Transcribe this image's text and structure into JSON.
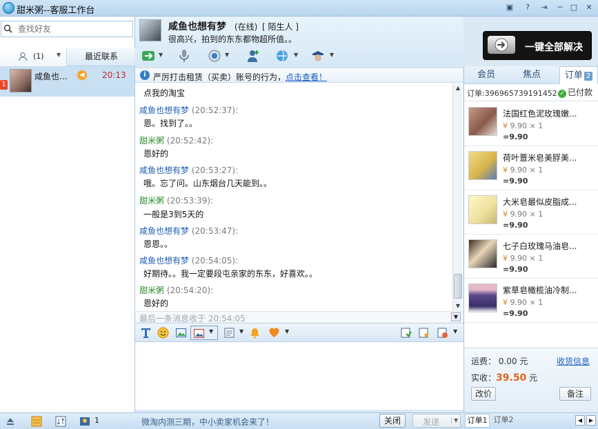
{
  "window": {
    "title": "甜米粥--客服工作台",
    "buttons": [
      "▣",
      "?",
      "⇥",
      "─",
      "□",
      "✕"
    ]
  },
  "sidebar": {
    "search_placeholder": "查找好友",
    "tab_contacts_count": "(1)",
    "tab_recent": "最近联系",
    "contact": {
      "name": "咸鱼也...",
      "time": "20:13",
      "unread": "1"
    }
  },
  "header": {
    "name": "咸鱼也想有梦",
    "status": "(在线)",
    "tag": "[ 陌生人 ]",
    "signature": "很高兴，拍到的东东都物超所值。。",
    "banner_text": "一键全部解决"
  },
  "notice": {
    "text": "严厉打击租赁（买卖）账号的行为，",
    "link": "点击查看！"
  },
  "chat": {
    "first_line": "点我的淘宝",
    "messages": [
      {
        "sender": "咸鱼也想有梦",
        "time": "(20:52:37):",
        "text": "恩。找到了。。",
        "self": false
      },
      {
        "sender": "甜米粥",
        "time": "(20:52:42):",
        "text": "恩好的",
        "self": true
      },
      {
        "sender": "咸鱼也想有梦",
        "time": "(20:53:27):",
        "text": "哦。忘了问。山东烟台几天能到。。",
        "self": false
      },
      {
        "sender": "甜米粥",
        "time": "(20:53:39):",
        "text": "一般是3到5天的",
        "self": true
      },
      {
        "sender": "咸鱼也想有梦",
        "time": "(20:53:47):",
        "text": "恩恩。。",
        "self": false
      },
      {
        "sender": "咸鱼也想有梦",
        "time": "(20:54:05):",
        "text": "好期待。。我一定要段屯亲家的东东，好喜欢。。",
        "self": false
      },
      {
        "sender": "甜米粥",
        "time": "(20:54:20):",
        "text": "恩好的",
        "self": true
      }
    ],
    "last_message": "最后一条消息收于 20:54:05"
  },
  "footer": {
    "promo": "微淘内测三期，中小卖家机会来了！",
    "close_button": "关闭",
    "send_button": "发送",
    "contacts_count": "1",
    "order_tab_1": "订单1",
    "order_tab_2": "订单2"
  },
  "order_panel": {
    "tabs": [
      "会员",
      "焦点",
      "订单"
    ],
    "order_count": "2",
    "order_no": "订单:396965739191452",
    "paid": "已付款",
    "products": [
      {
        "name": "法国红色泥玫瑰嫩...",
        "price": "9.90",
        "qty": "× 1",
        "total": "=9.90",
        "color": "#8a5a4a"
      },
      {
        "name": "荷叶薏米皂美脬美...",
        "price": "9.90",
        "qty": "× 1",
        "total": "=9.90",
        "color": "#d9b64a"
      },
      {
        "name": "大米皂最似皮脂成...",
        "price": "9.90",
        "qty": "× 1",
        "total": "=9.90",
        "color": "#efe3a0"
      },
      {
        "name": "七子白玫瑰马油皂...",
        "price": "9.90",
        "qty": "× 1",
        "total": "=9.90",
        "color": "#e8d6b6"
      },
      {
        "name": "紫草皂橄榄油冷制...",
        "price": "9.90",
        "qty": "× 1",
        "total": "=9.90",
        "color": "#5a4a8a"
      }
    ],
    "currency_symbol": "¥",
    "shipping_label": "运费：",
    "shipping_value": "0.00",
    "unit": "元",
    "ship_info_link": "收货信息",
    "actual_label": "实收：",
    "actual_value": "39.50",
    "discount_button": "改价",
    "note_button": "备注"
  }
}
